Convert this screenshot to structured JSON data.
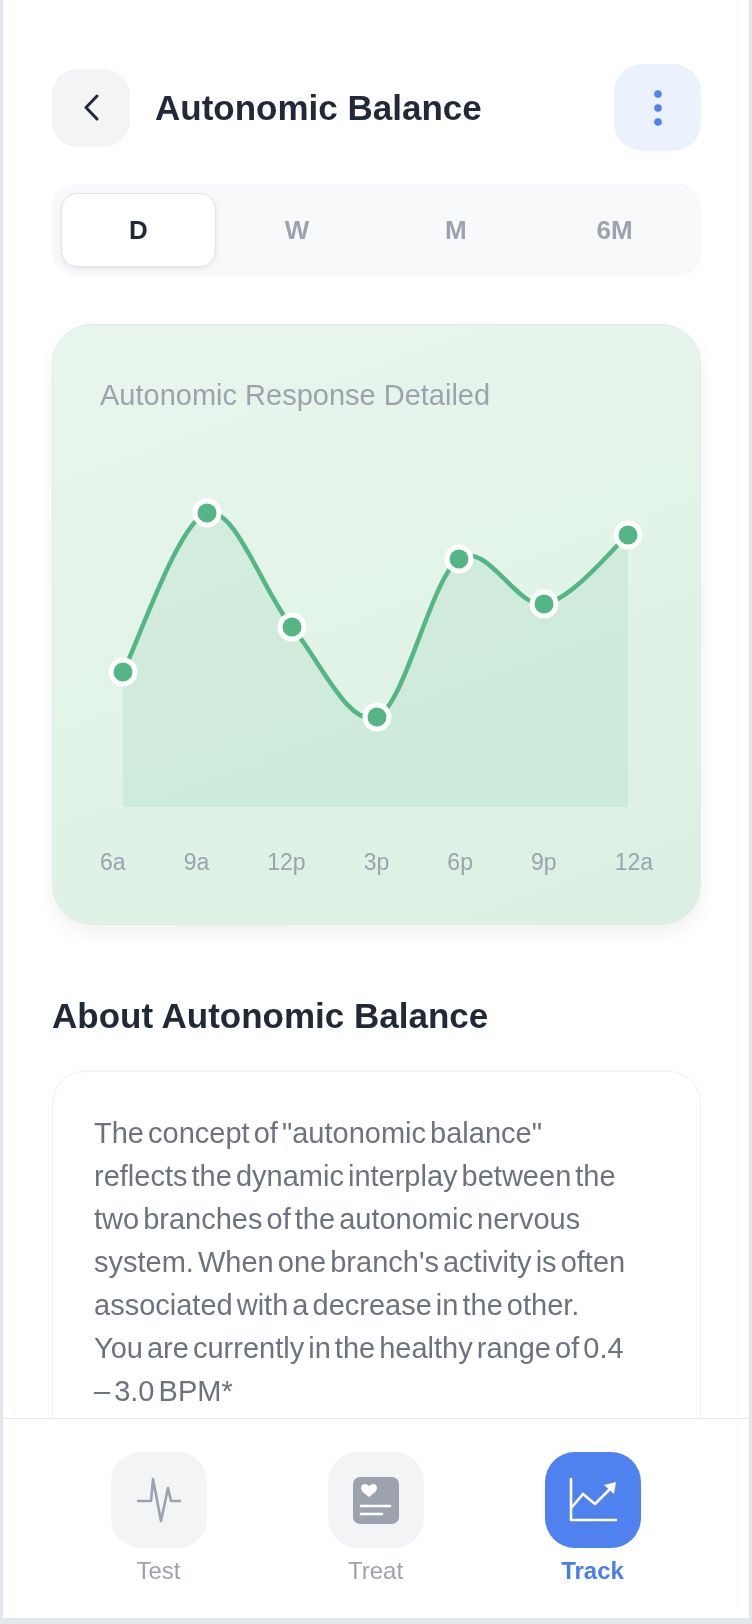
{
  "header": {
    "title": "Autonomic Balance"
  },
  "period_tabs": [
    {
      "label": "D",
      "selected": true
    },
    {
      "label": "W",
      "selected": false
    },
    {
      "label": "M",
      "selected": false
    },
    {
      "label": "6M",
      "selected": false
    }
  ],
  "chart_card": {
    "title": "Autonomic Response Detailed",
    "x_labels": [
      "6a",
      "9a",
      "12p",
      "3p",
      "6p",
      "9p",
      "12a"
    ]
  },
  "about": {
    "heading": "About Autonomic Balance",
    "text": "The concept of \"autonomic balance\" reflects the dynamic interplay between the two branches of the autonomic nervous system. When one branch's activity is often associated with a decrease in the other. You are currently in the healthy range of 0.4 – 3.0 BPM*"
  },
  "nav": {
    "items": [
      {
        "label": "Test",
        "selected": false
      },
      {
        "label": "Treat",
        "selected": false
      },
      {
        "label": "Track",
        "selected": true
      }
    ]
  }
}
